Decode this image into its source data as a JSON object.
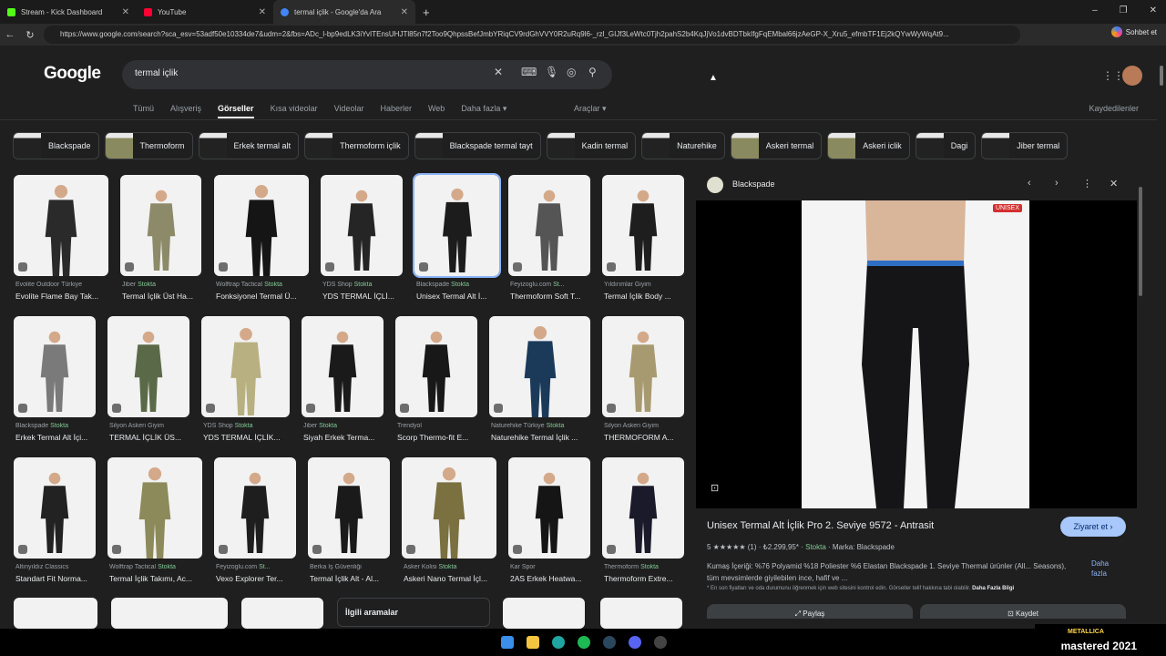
{
  "browser": {
    "tabs": [
      {
        "title": "Stream - Kick Dashboard",
        "color": "#53fc18"
      },
      {
        "title": "YouTube",
        "color": "#ff0033"
      },
      {
        "title": "termal içlik - Google'da Ara",
        "color": "#4285f4"
      }
    ],
    "url": "https://www.google.com/search?sca_esv=53adf50e10334de7&udm=2&fbs=ADc_l-bp9edLK3iYvITEnsUHJTl85n7f2Too9QhpssBefJmbYRiqCV9rdGhVVY0R2uRq9l6-_rzl_GIJf3LeWtc0Tjh2pahS2b4KqJjVo1dvBDTbkIfgFqEMbal66jzAeGP-X_Xru5_efmbTF1Ej2kQYwWyWqAt9...",
    "copilot_label": "Sohbet et"
  },
  "google": {
    "logo": "Google",
    "query": "termal içlik",
    "tabs": [
      "Tümü",
      "Alışveriş",
      "Görseller",
      "Kısa videolar",
      "Videolar",
      "Haberler",
      "Web",
      "Daha fazla ▾"
    ],
    "tools": "Araçlar ▾",
    "saved": "Kaydedilenler",
    "chips": [
      {
        "label": "Blackspade",
        "tone": "k"
      },
      {
        "label": "Thermoform",
        "tone": "o"
      },
      {
        "label": "Erkek termal alt",
        "tone": "k"
      },
      {
        "label": "Thermoform içlik",
        "tone": "k"
      },
      {
        "label": "Blackspade termal tayt",
        "tone": "k"
      },
      {
        "label": "Kadin termal",
        "tone": "k"
      },
      {
        "label": "Naturehike",
        "tone": "k"
      },
      {
        "label": "Askeri termal",
        "tone": "o"
      },
      {
        "label": "Askeri iclik",
        "tone": "o"
      },
      {
        "label": "Dagi",
        "tone": "k"
      },
      {
        "label": "Jiber termal",
        "tone": "k"
      }
    ],
    "results": [
      {
        "src": "Evolite Outdoor Türkiye",
        "stock": "",
        "title": "Evolite Flame Bay Tak...",
        "tone": "#2a2a2a"
      },
      {
        "src": "Jiber",
        "stock": "Stokta",
        "title": "Termal İçlik Üst Ha...",
        "tone": "#8c8a68"
      },
      {
        "src": "Wolftrap Tactical",
        "stock": "Stokta",
        "title": "Fonksiyonel Termal Ü...",
        "tone": "#151515"
      },
      {
        "src": "YDS Shop",
        "stock": "Stokta",
        "title": "YDS TERMAL İÇLİ...",
        "tone": "#252525"
      },
      {
        "src": "Blackspade",
        "stock": "Stokta",
        "title": "Unisex Termal Alt İ...",
        "tone": "#1c1c1c"
      },
      {
        "src": "Feyizoglu.com",
        "stock": "St...",
        "title": "Thermoform Soft T...",
        "tone": "#555555"
      },
      {
        "src": "Yıldırımlar Giyim",
        "stock": "",
        "title": "Termal İçlik Body ...",
        "tone": "#1e1e1e"
      },
      {
        "src": "Blackspade",
        "stock": "Stokta",
        "title": "Erkek Termal Alt İçi...",
        "tone": "#7a7a7a"
      },
      {
        "src": "Silyon Askeri Giyim",
        "stock": "",
        "title": "TERMAL İÇLİK ÜS...",
        "tone": "#5a6a48"
      },
      {
        "src": "YDS Shop",
        "stock": "Stokta",
        "title": "YDS TERMAL İÇLİK...",
        "tone": "#b8b080"
      },
      {
        "src": "Jiber",
        "stock": "Stokta",
        "title": "Siyah Erkek Terma...",
        "tone": "#1a1a1a"
      },
      {
        "src": "Trendyol",
        "stock": "",
        "title": "Scorp Thermo-fit E...",
        "tone": "#181818"
      },
      {
        "src": "Naturehike Türkiye",
        "stock": "Stokta",
        "title": "Naturehike Termal İçlik ...",
        "tone": "#1b3a5a"
      },
      {
        "src": "Silyon Askeri Giyim",
        "stock": "",
        "title": "THERMOFORM A...",
        "tone": "#a89a70"
      },
      {
        "src": "Altınyıldız Classics",
        "stock": "",
        "title": "Standart Fit Norma...",
        "tone": "#222222"
      },
      {
        "src": "Wolftrap Tactical",
        "stock": "Stokta",
        "title": "Termal İçlik Takımı, Ac...",
        "tone": "#8c8a5a"
      },
      {
        "src": "Feyizoglu.com",
        "stock": "St...",
        "title": "Vexo Explorer Ter...",
        "tone": "#1e1e1e"
      },
      {
        "src": "Berka İş Güvenliği",
        "stock": "",
        "title": "Termal İçlik Alt - Al...",
        "tone": "#1a1a1a"
      },
      {
        "src": "Asker Kolisi",
        "stock": "Stokta",
        "title": "Askeri Nano Termal İçl...",
        "tone": "#7a7040"
      },
      {
        "src": "Kar Spor",
        "stock": "",
        "title": "2AS Erkek Heatwa...",
        "tone": "#151515"
      },
      {
        "src": "Thermoform",
        "stock": "Stokta",
        "title": "Thermoform Extre...",
        "tone": "#1a1a2a"
      }
    ],
    "related_label": "İlgili aramalar"
  },
  "panel": {
    "site": "Blackspade",
    "badge": "UNISEX",
    "product_name": "Unisex Termal Alt İçlik Pro 2. Seviye 9572 - Antrasit",
    "visit": "Ziyaret et ›",
    "rating_text": "5 ★★★★★ (1) · ₺2.299,95* ·",
    "stock": "Stokta",
    "brand": "· Marka: Blackspade",
    "description": "Kumaş İçeriği: %76 Polyamid %18 Poliester %6 Elastan Blackspade 1. Seviye Thermal ürünler (All... Seasons), tüm mevsimlerde giyilebilen ince, hafif ve ...",
    "more": "Daha fazla",
    "note": "* En son fiyatları ve oda durumunu öğrenmek için web sitesini kontrol edin. Görseller telif hakkına tabi olabilir.",
    "note_link": "Daha Fazla Bilgi",
    "share": "⤢ Paylaş",
    "save": "⊡ Kaydet"
  },
  "taskbar": {
    "now_playing_artist": "METALLICA",
    "now_playing_title": "mastered 2021"
  }
}
